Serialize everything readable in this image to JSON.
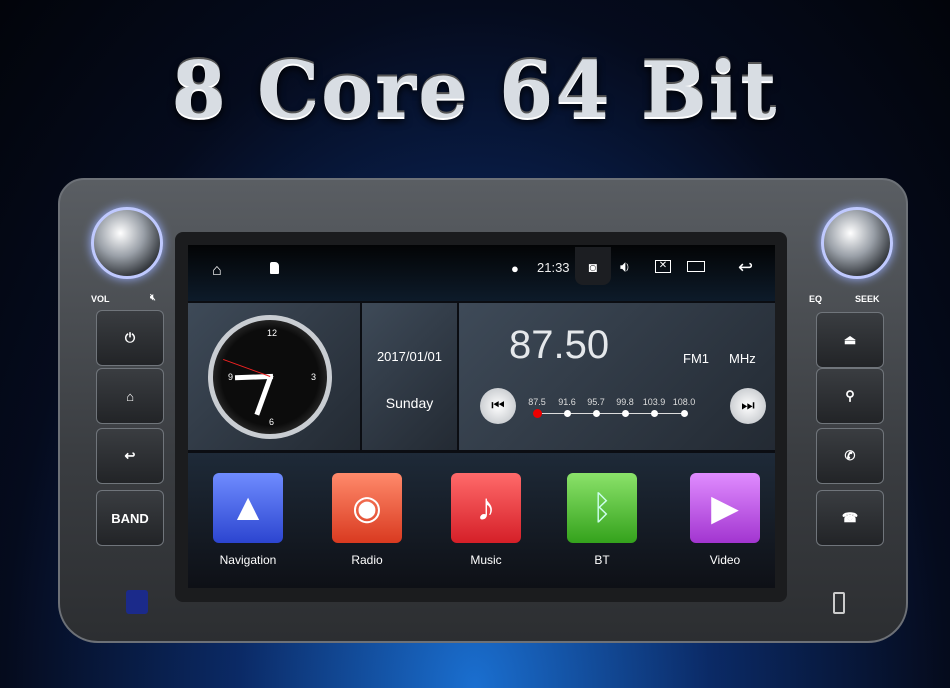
{
  "headline": "8 Core 64 Bit",
  "device": {
    "left_labels": {
      "vol": "VOL",
      "band": "BAND"
    },
    "right_labels": {
      "eq": "EQ",
      "seek": "SEEK"
    }
  },
  "status_bar": {
    "time": "21:33",
    "icons": [
      "home-icon",
      "sd-card-icon",
      "location-icon",
      "camera-icon",
      "volume-icon",
      "close-window-icon",
      "recent-apps-icon",
      "back-icon"
    ]
  },
  "clock": {
    "numbers": [
      "12",
      "3",
      "6",
      "9"
    ],
    "time": "21:33"
  },
  "date": {
    "date": "2017/01/01",
    "day": "Sunday"
  },
  "radio": {
    "frequency": "87.50",
    "band": "FM1",
    "unit": "MHz",
    "presets": [
      "87.5",
      "91.6",
      "95.7",
      "99.8",
      "103.9",
      "108.0"
    ],
    "active_preset": 0
  },
  "apps": [
    {
      "label": "Navigation",
      "color": "#3a5be0"
    },
    {
      "label": "Radio",
      "color": "#e8533a"
    },
    {
      "label": "Music",
      "color": "#e8303a"
    },
    {
      "label": "BT",
      "color": "#4cbf2e"
    },
    {
      "label": "Video",
      "color": "#b64de0"
    }
  ]
}
